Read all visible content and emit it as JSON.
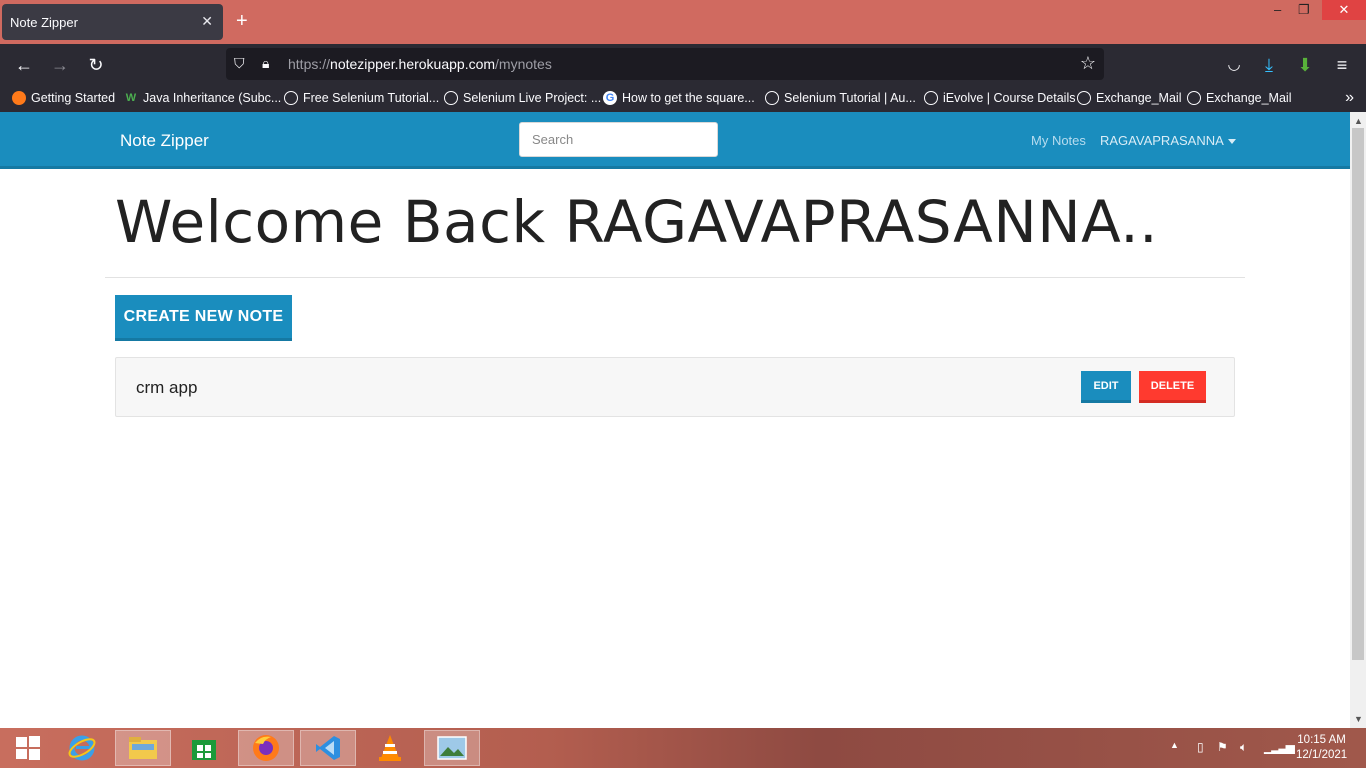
{
  "browser": {
    "tab_title": "Note Zipper",
    "tab_close": "✕",
    "new_tab": "+",
    "url_scheme": "https://",
    "url_host": "notezipper.herokuapp.com",
    "url_path": "/mynotes",
    "window_controls": {
      "minimize": "–",
      "maximize": "❐",
      "close": "✕"
    },
    "bookmarks": [
      {
        "label": "Getting Started",
        "icon": "firefox-icon"
      },
      {
        "label": "Java Inheritance (Subc...",
        "icon": "w-icon"
      },
      {
        "label": "Free Selenium Tutorial...",
        "icon": "globe-icon"
      },
      {
        "label": "Selenium Live Project: ...",
        "icon": "globe-icon"
      },
      {
        "label": "How to get the square...",
        "icon": "google-icon"
      },
      {
        "label": "Selenium Tutorial | Au...",
        "icon": "globe-icon"
      },
      {
        "label": "iEvolve | Course Details",
        "icon": "globe-icon"
      },
      {
        "label": "Exchange_Mail",
        "icon": "globe-icon"
      },
      {
        "label": "Exchange_Mail",
        "icon": "globe-icon"
      }
    ]
  },
  "navbar": {
    "brand": "Note Zipper",
    "search_placeholder": "Search",
    "my_notes": "My Notes",
    "user": "RAGAVAPRASANNA"
  },
  "main": {
    "heading": "Welcome Back RAGAVAPRASANNA..",
    "create_button": "CREATE NEW NOTE",
    "notes": [
      {
        "title": "crm app",
        "edit": "EDIT",
        "delete": "DELETE"
      }
    ]
  },
  "taskbar": {
    "time": "10:15 AM",
    "date": "12/1/2021"
  },
  "colors": {
    "brand_blue": "#1a8dbe",
    "delete_red": "#ff3a2f",
    "titlebar": "#d06a60"
  }
}
